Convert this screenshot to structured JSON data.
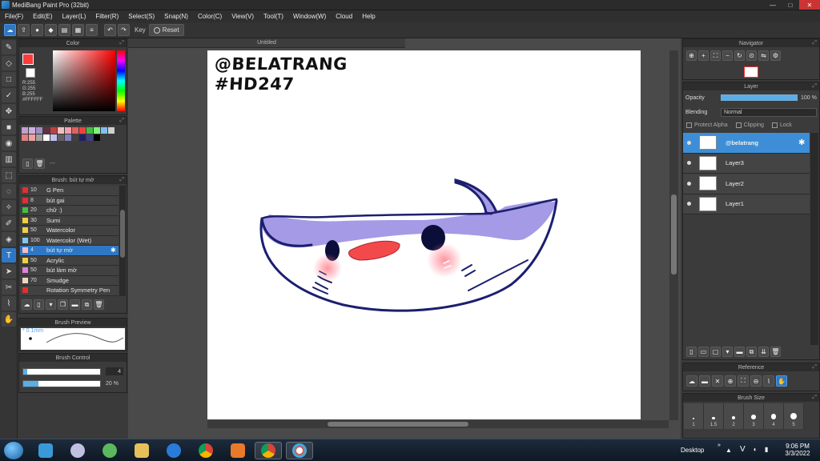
{
  "window": {
    "title": "MediBang Paint Pro (32bit)",
    "min": "—",
    "max": "□",
    "close": "✕"
  },
  "menu": [
    "File(F)",
    "Edit(E)",
    "Layer(L)",
    "Filter(R)",
    "Select(S)",
    "Snap(N)",
    "Color(C)",
    "View(V)",
    "Tool(T)",
    "Window(W)",
    "Cloud",
    "Help"
  ],
  "toolbar": {
    "key_label": "Key",
    "reset_label": "Reset"
  },
  "panels": {
    "color": {
      "title": "Color",
      "rgb": [
        "R:255",
        "G:255",
        "B:255"
      ],
      "hex": "#FFFFFF",
      "fg": "#ff3b3b"
    },
    "palette": {
      "title": "Palette",
      "dashes": "---",
      "colors": [
        "#c0a0d0",
        "#d0b0e0",
        "#a090c0",
        "#603040",
        "#c04040",
        "#f0c0c0",
        "#f0a0b0",
        "#e06060",
        "#f04040",
        "#40c040",
        "#80f080",
        "#80c0f0",
        "#d0d0d0",
        "#e08080",
        "#f0a0a0",
        "#a0a0a0",
        "#ffffff",
        "#c0c0f0",
        "#606060",
        "#8080c0",
        "#404040",
        "#202060",
        "#404080",
        "#000000"
      ]
    },
    "brush": {
      "title": "Brush: bút tự mờ",
      "items": [
        {
          "size": "10",
          "name": "G Pen",
          "color": "#e03030"
        },
        {
          "size": "8",
          "name": "bút gai",
          "color": "#e03030"
        },
        {
          "size": "20",
          "name": "chữ :)",
          "color": "#40c040"
        },
        {
          "size": "30",
          "name": "Sumi",
          "color": "#f0d040"
        },
        {
          "size": "50",
          "name": "Watercolor",
          "color": "#f0d040"
        },
        {
          "size": "100",
          "name": "Watercolor (Wet)",
          "color": "#80c8f0"
        },
        {
          "size": "4",
          "name": "bút tự mờ",
          "color": "#f0c0c0",
          "active": true
        },
        {
          "size": "50",
          "name": "Acrylic",
          "color": "#f0d040"
        },
        {
          "size": "50",
          "name": "bút làm mờ",
          "color": "#e080e0"
        },
        {
          "size": "70",
          "name": "Smudge",
          "color": "#f0d8c0"
        },
        {
          "size": "",
          "name": "Rotation Symmetry Pen",
          "color": "#e03030"
        }
      ]
    },
    "preview": {
      "title": "Brush Preview",
      "size": "* 0.1mm"
    },
    "control": {
      "title": "Brush Control",
      "size_val": "4",
      "size_fill": 0.05,
      "opacity_val": "20 %",
      "opacity_fill": 0.2
    },
    "navigator": {
      "title": "Navigator"
    },
    "layer": {
      "title": "Layer",
      "opacity_label": "Opacity",
      "opacity_val": "100 %",
      "blending_label": "Blending",
      "blending_val": "Normal",
      "protect_alpha": "Protect Alpha",
      "clipping": "Clipping",
      "lock": "Lock",
      "layers": [
        {
          "name": "@belatrang",
          "active": true
        },
        {
          "name": "Layer3"
        },
        {
          "name": "Layer2"
        },
        {
          "name": "Layer1"
        }
      ]
    },
    "reference": {
      "title": "Reference"
    },
    "brush_size": {
      "title": "Brush Size",
      "sizes": [
        "1",
        "1.5",
        "2",
        "3",
        "4",
        "5"
      ]
    }
  },
  "document": {
    "tab": "Untitled",
    "text_line1": "@BELATRANG",
    "text_line2": "#HD247"
  },
  "taskbar": {
    "desktop_label": "Desktop",
    "lang": "V",
    "time": "9:06 PM",
    "date": "3/3/2022"
  }
}
